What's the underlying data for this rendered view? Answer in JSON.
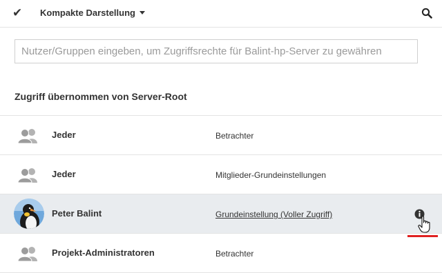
{
  "toolbar": {
    "check_icon": "check-icon",
    "view_label": "Kompakte Darstellung",
    "search_icon": "search-icon"
  },
  "search": {
    "placeholder": "Nutzer/Gruppen eingeben, um Zugriffsrechte für Balint-hp-Server zu gewähren",
    "value": ""
  },
  "section": {
    "title": "Zugriff übernommen von Server-Root"
  },
  "rows": [
    {
      "name": "Jeder",
      "role": "Betrachter",
      "icon": "group-icon"
    },
    {
      "name": "Jeder",
      "role": "Mitglieder-Grundeinstellungen",
      "icon": "group-icon"
    },
    {
      "name": "Peter Balint",
      "role": "Grundeinstellung  (Voller Zugriff)",
      "icon": "user-avatar",
      "selected": true,
      "info_icon": "info-icon"
    },
    {
      "name": "Projekt-Administratoren",
      "role": "Betrachter",
      "icon": "group-icon"
    }
  ],
  "colors": {
    "selected_row": "#e9ecef",
    "annotation_mark": "#e02020",
    "text": "#333333"
  }
}
